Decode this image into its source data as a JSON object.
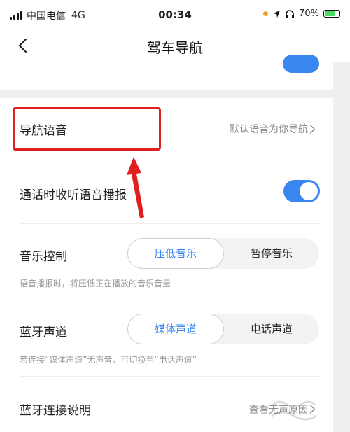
{
  "status_bar": {
    "carrier": "中国电信",
    "network": "4G",
    "time": "00:34",
    "battery": "70%"
  },
  "nav": {
    "title": "驾车导航"
  },
  "rows": {
    "voice": {
      "label": "导航语音",
      "value": "默认语音为你导航"
    },
    "call_listen": {
      "label": "通话时收听语音播报",
      "enabled": true
    },
    "music": {
      "label": "音乐控制",
      "options": [
        "压低音乐",
        "暂停音乐"
      ],
      "selected": "压低音乐",
      "hint": "语音播报时，将压低正在播放的音乐音量"
    },
    "bluetooth": {
      "label": "蓝牙声道",
      "options": [
        "媒体声道",
        "电话声道"
      ],
      "selected": "媒体声道",
      "hint": "若连接“媒体声道”无声音，可切换至“电话声道”"
    },
    "bt_help": {
      "label": "蓝牙连接说明",
      "value": "查看无声原因"
    }
  },
  "colors": {
    "accent": "#3a86f0",
    "annotation": "#e02020"
  }
}
